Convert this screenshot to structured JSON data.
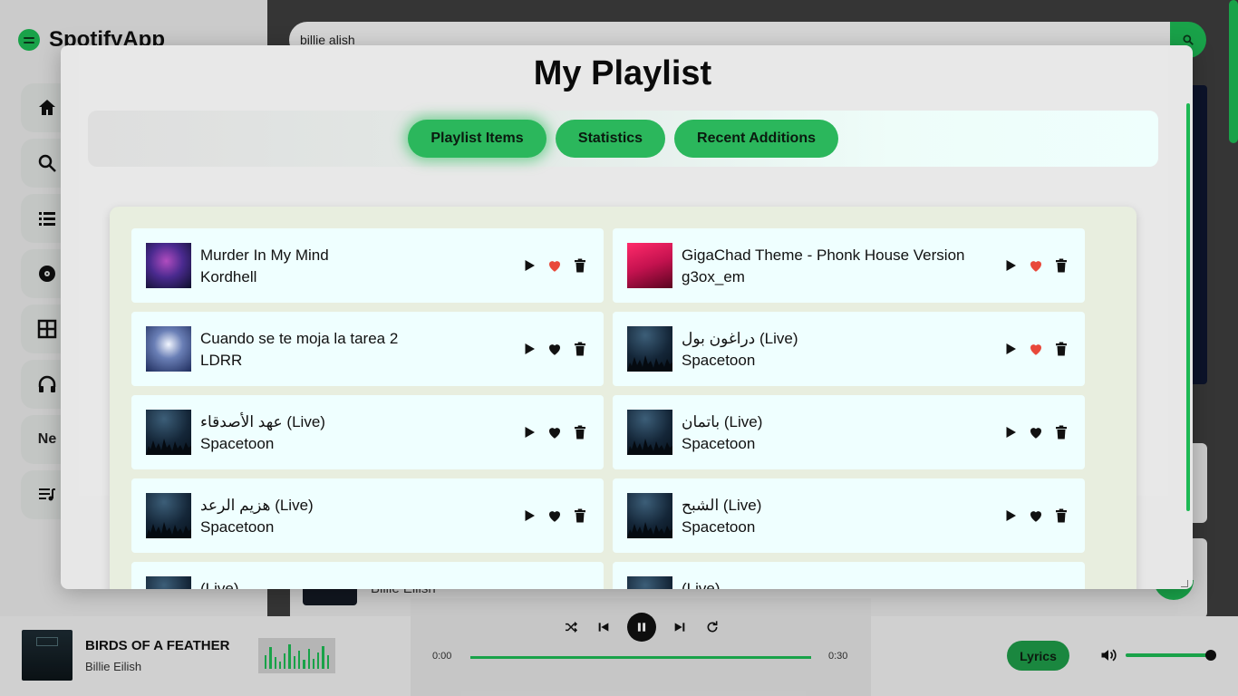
{
  "app": {
    "name": "SpotifyApp"
  },
  "sidebar": {
    "items": [
      {
        "icon": "home-icon"
      },
      {
        "icon": "search-icon"
      },
      {
        "icon": "list-icon"
      },
      {
        "icon": "disc-icon"
      },
      {
        "icon": "grid-icon"
      },
      {
        "icon": "headphones-icon"
      },
      {
        "label": "Ne"
      },
      {
        "icon": "queue-music-icon"
      }
    ]
  },
  "search": {
    "value": "billie alish"
  },
  "background": {
    "row_artist": "Billie Eilish"
  },
  "modal": {
    "title": "My Playlist",
    "tabs": [
      {
        "label": "Playlist Items",
        "active": true
      },
      {
        "label": "Statistics",
        "active": false
      },
      {
        "label": "Recent Additions",
        "active": false
      }
    ]
  },
  "tracks": [
    {
      "title": "Murder In My Mind",
      "artist": "Kordhell",
      "thumb": "mind",
      "liked": true
    },
    {
      "title": "GigaChad Theme - Phonk House Version",
      "artist": "g3ox_em",
      "thumb": "giga",
      "liked": true
    },
    {
      "title": "Cuando se te moja la tarea 2",
      "artist": "LDRR",
      "thumb": "tarea",
      "liked": false
    },
    {
      "title": "دراغون بول (Live)",
      "artist": "Spacetoon",
      "thumb": "forest",
      "liked": true
    },
    {
      "title": "عهد الأصدقاء (Live)",
      "artist": "Spacetoon",
      "thumb": "forest",
      "liked": false
    },
    {
      "title": "باتمان (Live)",
      "artist": "Spacetoon",
      "thumb": "forest",
      "liked": false
    },
    {
      "title": "هزيم الرعد (Live)",
      "artist": "Spacetoon",
      "thumb": "forest",
      "liked": false
    },
    {
      "title": "الشبح (Live)",
      "artist": "Spacetoon",
      "thumb": "forest",
      "liked": false
    },
    {
      "title": "(Live)",
      "artist": "",
      "thumb": "forest",
      "liked": false
    },
    {
      "title": "(Live)",
      "artist": "",
      "thumb": "forest",
      "liked": false
    }
  ],
  "player": {
    "title": "BIRDS OF A FEATHER",
    "artist": "Billie Eilish",
    "time_current": "0:00",
    "time_total": "0:30",
    "progress": 1.0,
    "volume": 1.0,
    "lyrics_label": "Lyrics",
    "visualizer_levels": [
      0.55,
      0.85,
      0.45,
      0.3,
      0.6,
      0.95,
      0.5,
      0.7,
      0.35,
      0.8,
      0.4,
      0.65,
      0.9,
      0.55
    ],
    "playing": true
  },
  "colors": {
    "accent": "#1db954",
    "liked": "#e8483a",
    "unliked": "#111111",
    "card_bg": "#efffff"
  }
}
